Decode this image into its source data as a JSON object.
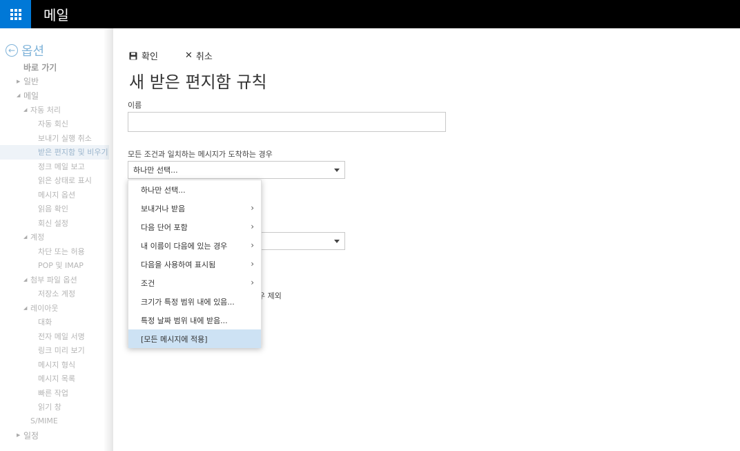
{
  "app": {
    "title": "메일"
  },
  "sidebar": {
    "header": "옵션",
    "items": [
      {
        "label": "바로 가기",
        "level": "l1",
        "bold": true
      },
      {
        "label": "일반",
        "level": "l1",
        "arrow": "right"
      },
      {
        "label": "메일",
        "level": "l1",
        "arrow": "down"
      },
      {
        "label": "자동 처리",
        "level": "l2",
        "arrow": "down"
      },
      {
        "label": "자동 회신",
        "level": "l3"
      },
      {
        "label": "보내기 실행 취소",
        "level": "l3"
      },
      {
        "label": "받은 편지함 및 비우기",
        "level": "l3",
        "selected": true
      },
      {
        "label": "정크 메일 보고",
        "level": "l3"
      },
      {
        "label": "읽은 상태로 표시",
        "level": "l3"
      },
      {
        "label": "메시지 옵션",
        "level": "l3"
      },
      {
        "label": "읽음 확인",
        "level": "l3"
      },
      {
        "label": "회신 설정",
        "level": "l3"
      },
      {
        "label": "계정",
        "level": "l2",
        "arrow": "down"
      },
      {
        "label": "차단 또는 허용",
        "level": "l3"
      },
      {
        "label": "POP 및 IMAP",
        "level": "l3"
      },
      {
        "label": "첨부 파일 옵션",
        "level": "l2",
        "arrow": "down"
      },
      {
        "label": "저장소 계정",
        "level": "l3"
      },
      {
        "label": "레이아웃",
        "level": "l2",
        "arrow": "down"
      },
      {
        "label": "대화",
        "level": "l3"
      },
      {
        "label": "전자 메일 서명",
        "level": "l3"
      },
      {
        "label": "링크 미리 보기",
        "level": "l3"
      },
      {
        "label": "메시지 형식",
        "level": "l3"
      },
      {
        "label": "메시지 목록",
        "level": "l3"
      },
      {
        "label": "빠른 작업",
        "level": "l3"
      },
      {
        "label": "읽기 창",
        "level": "l3"
      },
      {
        "label": "S/MIME",
        "level": "l2"
      },
      {
        "label": "일정",
        "level": "l1",
        "arrow": "right"
      }
    ]
  },
  "toolbar": {
    "ok_label": "확인",
    "cancel_label": "취소"
  },
  "form": {
    "title": "새 받은 편지함 규칙",
    "name_label": "이름",
    "name_value": "",
    "condition_label": "모든 조건과 일치하는 메시지가 도착하는 경우",
    "condition_value": "하나만 선택...",
    "exception_partial": "우 제외"
  },
  "dropdown": {
    "items": [
      {
        "label": "하나만 선택...",
        "submenu": false
      },
      {
        "label": "보내거나 받음",
        "submenu": true
      },
      {
        "label": "다음 단어 포함",
        "submenu": true
      },
      {
        "label": "내 이름이 다음에 있는 경우",
        "submenu": true
      },
      {
        "label": "다음을 사용하여 표시됨",
        "submenu": true
      },
      {
        "label": "조건",
        "submenu": true
      },
      {
        "label": "크기가 특정 범위 내에 있음...",
        "submenu": false
      },
      {
        "label": "특정 날짜 범위 내에 받음...",
        "submenu": false
      },
      {
        "label": "[모든 메시지에 적용]",
        "submenu": false,
        "highlighted": true
      }
    ]
  },
  "colors": {
    "accent": "#0078d7",
    "topbar": "#000000",
    "highlight": "#cde2f4"
  }
}
